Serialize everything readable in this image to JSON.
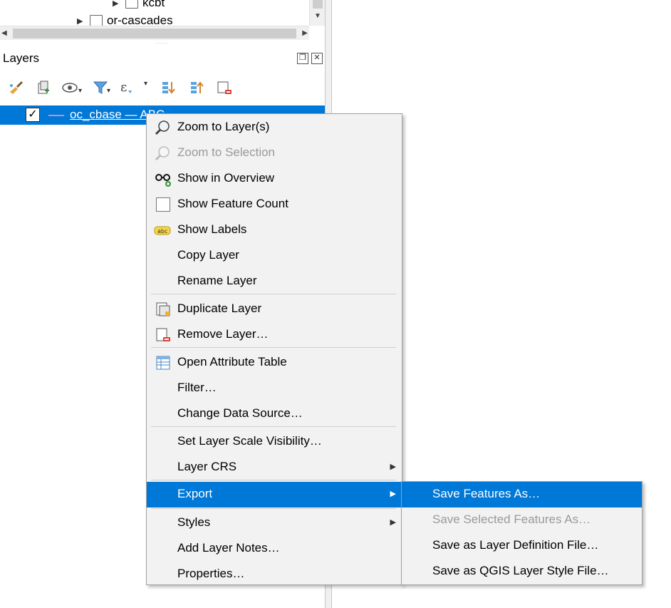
{
  "browser": {
    "items": [
      {
        "label": "kcbt"
      },
      {
        "label": "or-cascades"
      }
    ]
  },
  "layers_panel": {
    "title": "Layers",
    "layer": {
      "name": "oc_cbase — ABC",
      "checked": "✓"
    }
  },
  "toolbar": {
    "icons": [
      "paint-brush-icon",
      "add-group-icon",
      "eye-icon",
      "filter-icon",
      "expression-filter-icon",
      "expand-all-icon",
      "collapse-all-icon",
      "remove-layer-icon"
    ]
  },
  "context_menu": {
    "items": [
      {
        "label": "Zoom to Layer(s)",
        "icon": "zoom-layer-icon",
        "enabled": true
      },
      {
        "label": "Zoom to Selection",
        "icon": "zoom-selection-icon",
        "enabled": false
      },
      {
        "label": "Show in Overview",
        "icon": "overview-glasses-icon",
        "enabled": true
      },
      {
        "label": "Show Feature Count",
        "icon": "checkbox-icon",
        "enabled": true
      },
      {
        "label": "Show Labels",
        "icon": "labels-abc-icon",
        "enabled": true
      },
      {
        "label": "Copy Layer",
        "enabled": true
      },
      {
        "label": "Rename Layer",
        "enabled": true
      },
      {
        "label": "Duplicate Layer",
        "icon": "duplicate-layer-icon",
        "enabled": true
      },
      {
        "label": "Remove Layer…",
        "icon": "remove-layer-icon",
        "enabled": true
      },
      {
        "label": "Open Attribute Table",
        "icon": "attribute-table-icon",
        "enabled": true
      },
      {
        "label": "Filter…",
        "enabled": true
      },
      {
        "label": "Change Data Source…",
        "enabled": true
      },
      {
        "label": "Set Layer Scale Visibility…",
        "enabled": true
      },
      {
        "label": "Layer CRS",
        "enabled": true,
        "submenu": true
      },
      {
        "label": "Export",
        "enabled": true,
        "submenu": true,
        "active": true
      },
      {
        "label": "Styles",
        "enabled": true,
        "submenu": true
      },
      {
        "label": "Add Layer Notes…",
        "enabled": true
      },
      {
        "label": "Properties…",
        "enabled": true
      }
    ]
  },
  "export_submenu": {
    "items": [
      {
        "label": "Save Features As…",
        "active": true
      },
      {
        "label": "Save Selected Features As…",
        "enabled": false
      },
      {
        "label": "Save as Layer Definition File…"
      },
      {
        "label": "Save as QGIS Layer Style File…"
      }
    ]
  },
  "colors": {
    "selection": "#0078d7",
    "menu_bg": "#f2f2f2",
    "disabled_text": "#9a9a9a",
    "layer_symbol": "#c48fc7"
  }
}
